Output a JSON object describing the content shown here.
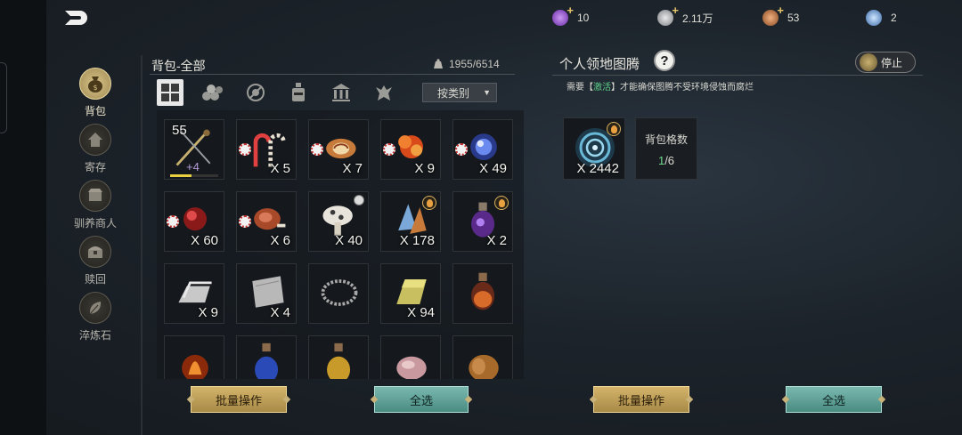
{
  "currency": [
    {
      "icon": "purple-gem-icon",
      "value": "10",
      "color": "#8a4ad0"
    },
    {
      "icon": "silver-coin-icon",
      "value": "2.11万",
      "color": "#b0b4b8"
    },
    {
      "icon": "copper-coin-icon",
      "value": "53",
      "color": "#c06a3a"
    },
    {
      "icon": "blue-crystal-icon",
      "value": "2",
      "color": "#5a9ad8"
    }
  ],
  "nav": [
    {
      "label": "背包",
      "icon": "bag-icon",
      "active": true
    },
    {
      "label": "寄存",
      "icon": "house-icon",
      "active": false
    },
    {
      "label": "驯养商人",
      "icon": "merchant-icon",
      "active": false
    },
    {
      "label": "赎回",
      "icon": "chest-icon",
      "active": false
    },
    {
      "label": "淬炼石",
      "icon": "leaf-stone-icon",
      "active": false
    }
  ],
  "bag": {
    "title": "背包-全部",
    "capacity": "1955/6514",
    "sort_label": "按类别",
    "batch_label": "批量操作",
    "select_all_label": "全选",
    "items": [
      {
        "art": "weapon",
        "level": "55",
        "plus": "+4",
        "durability": 0.45
      },
      {
        "art": "candy-cane",
        "qty": "X 5",
        "gear": true
      },
      {
        "art": "cake-roll",
        "qty": "X 7",
        "gear": true
      },
      {
        "art": "fire-flower",
        "qty": "X 9",
        "gear": true
      },
      {
        "art": "blue-orb",
        "qty": "X 49",
        "gear": true
      },
      {
        "art": "red-orb",
        "qty": "X 60",
        "gear": true
      },
      {
        "art": "meat",
        "qty": "X 6",
        "gear": true
      },
      {
        "art": "mushroom",
        "qty": "X 40",
        "link": true
      },
      {
        "art": "crystal-shard",
        "qty": "X 178",
        "flame": true
      },
      {
        "art": "purple-potion",
        "qty": "X 2",
        "flame": true
      },
      {
        "art": "silver-ingot",
        "qty": "X 9"
      },
      {
        "art": "cloth",
        "qty": "X 4"
      },
      {
        "art": "chain",
        "qty": ""
      },
      {
        "art": "gold-bar",
        "qty": "X 94"
      },
      {
        "art": "orange-potion",
        "qty": ""
      },
      {
        "art": "flame-orb",
        "qty": ""
      },
      {
        "art": "blue-potion",
        "qty": ""
      },
      {
        "art": "gold-potion",
        "qty": ""
      },
      {
        "art": "pink-stone",
        "qty": ""
      },
      {
        "art": "leather-roll",
        "qty": ""
      }
    ]
  },
  "totem": {
    "title": "个人领地图腾",
    "help": "?",
    "stop_label": "停止",
    "note_before": "需要【",
    "note_highlight": "激活",
    "note_after": "】才能确保图腾不受环境侵蚀而腐烂",
    "item_qty": "X 2442",
    "count_label": "背包格数",
    "count_used": "1",
    "count_total": "/6",
    "batch_label": "批量操作",
    "select_all_label": "全选"
  }
}
